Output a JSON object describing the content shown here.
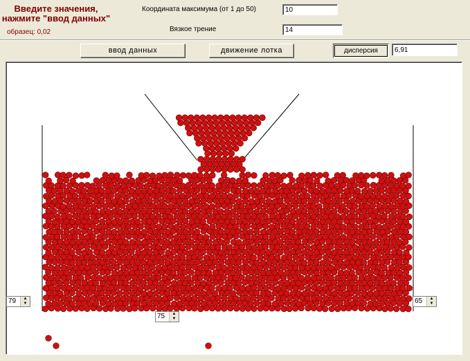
{
  "header": {
    "title_line1": "Введите значения,",
    "title_line2": "нажмите \"ввод данных\"",
    "sample_label": "образец: 0,02"
  },
  "params": {
    "max_coord_label": "Координата максимума (от 1 до 50)",
    "max_coord_value": "10",
    "viscous_label": "Вязкое трение",
    "viscous_value": "14"
  },
  "toolbar": {
    "input_button": "ввод  данных",
    "move_button": "движение лотка",
    "dispersion_button": "дисперсия",
    "dispersion_value": "6,91"
  },
  "spinners": {
    "left_value": "79",
    "bottom_value": "75",
    "right_value": "65"
  },
  "colors": {
    "ball_fill": "#cc1111",
    "ball_stroke": "#7a0000",
    "walls": "#000000",
    "title": "#800000"
  },
  "icons": {
    "spinner_up": "triangle-up-icon",
    "spinner_down": "triangle-down-icon"
  }
}
